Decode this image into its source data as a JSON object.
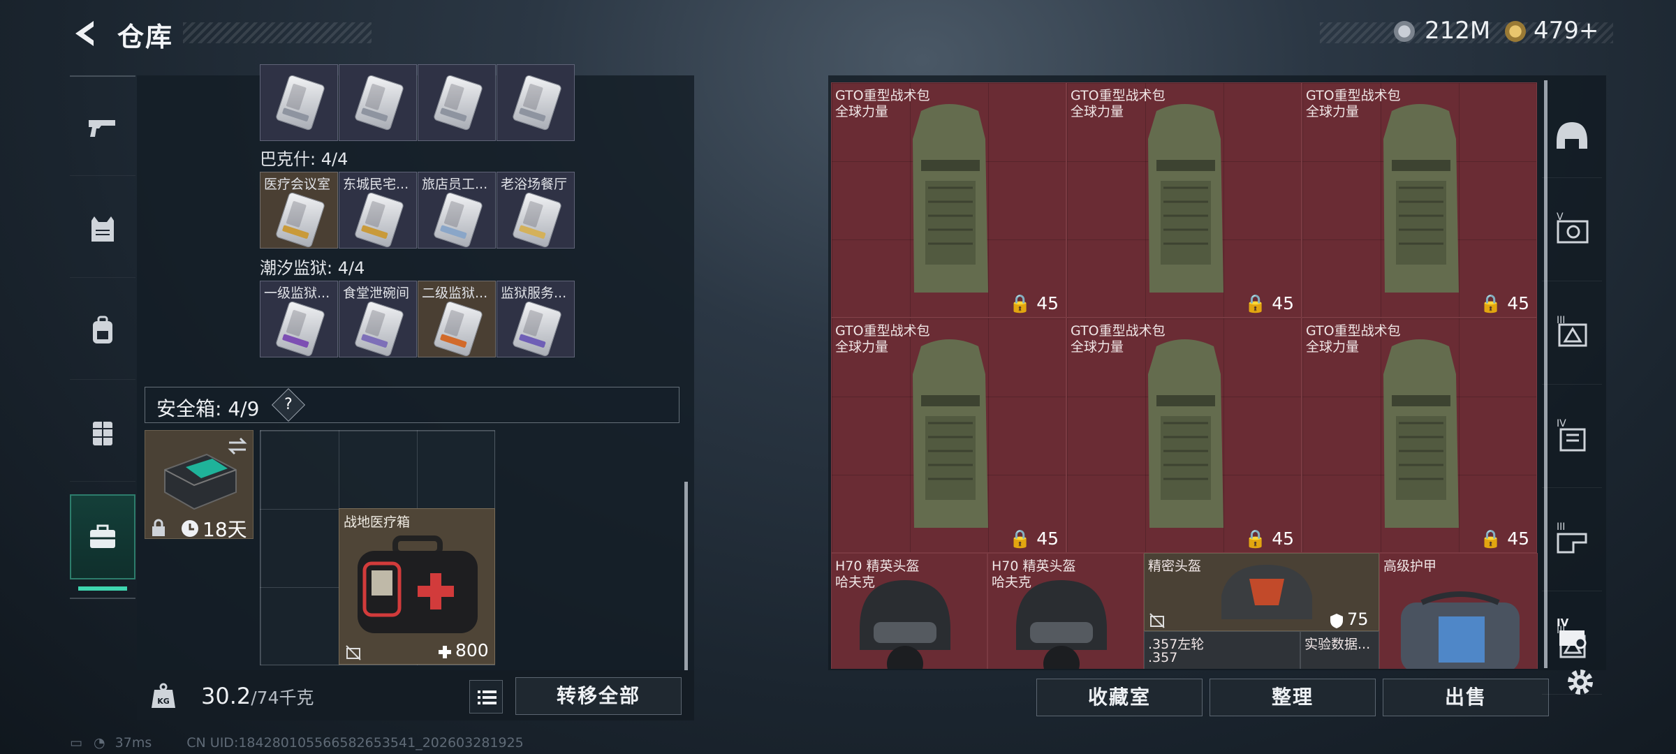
{
  "header": {
    "title": "仓库",
    "currency1": "212M",
    "currency2": "479+"
  },
  "left_nav": {
    "items": [
      {
        "icon": "pistol-icon"
      },
      {
        "icon": "armor-vest-icon"
      },
      {
        "icon": "backpack-icon"
      },
      {
        "icon": "chest-rig-icon"
      },
      {
        "icon": "toolbox-icon",
        "active": true
      }
    ]
  },
  "stash": {
    "top_row_labels": [
      "",
      "",
      "",
      ""
    ],
    "groups": [
      {
        "title": "巴克什: 4/4",
        "cards": [
          "医疗会议室",
          "东城民宅...",
          "旅店员工...",
          "老浴场餐厅"
        ]
      },
      {
        "title": "潮汐监狱: 4/4",
        "cards": [
          "一级监狱...",
          "食堂泄碗间",
          "二级监狱...",
          "监狱服务..."
        ]
      }
    ]
  },
  "safe": {
    "label": "安全箱: 4/9",
    "help": "?",
    "duration": "18天",
    "medkit_label": "战地医疗箱",
    "medkit_value": "800"
  },
  "bottom": {
    "weight_current": "30.2",
    "weight_max": "/74千克",
    "transfer_all": "转移全部",
    "kg_icon": "KG"
  },
  "inventory": {
    "bags": [
      {
        "name": "GTO重型战术包",
        "sub": "全球力量",
        "value": "45"
      },
      {
        "name": "GTO重型战术包",
        "sub": "全球力量",
        "value": "45"
      },
      {
        "name": "GTO重型战术包",
        "sub": "全球力量",
        "value": "45"
      },
      {
        "name": "GTO重型战术包",
        "sub": "全球力量",
        "value": "45"
      },
      {
        "name": "GTO重型战术包",
        "sub": "全球力量",
        "value": "45"
      },
      {
        "name": "GTO重型战术包",
        "sub": "全球力量",
        "value": "45"
      }
    ],
    "row3": [
      {
        "name": "H70 精英头盔",
        "sub": "哈夫克"
      },
      {
        "name": "H70 精英头盔",
        "sub": "哈夫克"
      },
      {
        "name": "精密头盔",
        "value": "75",
        "sub1": ".357左轮",
        "sub2": ".357"
      },
      {
        "name": "高级护甲",
        "sub1": "实验数据..."
      }
    ]
  },
  "actions": {
    "collection": "收藏室",
    "organize": "整理",
    "sell": "出售"
  },
  "right_nav": {
    "items": [
      "helmet-icon",
      "tier-v-armor-icon",
      "tier-iii-armor-icon",
      "tier-iv-rig-icon",
      "tier-iii-rig-icon",
      "tier-iii-pack-icon",
      "tier-iv-pack-icon"
    ],
    "labels": [
      "",
      "V",
      "III",
      "IV",
      "III",
      "III",
      "IV"
    ]
  },
  "status": {
    "ping": "37ms",
    "uid": "CN UID:1842801055665826535​41_202603281925"
  }
}
